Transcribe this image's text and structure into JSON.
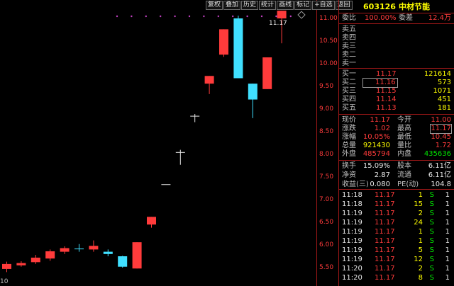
{
  "toolbar": {
    "items": [
      "复权",
      "叠加",
      "历史",
      "统计",
      "画线",
      "标记",
      "+自选",
      "返回"
    ]
  },
  "chart": {
    "price_ticks": [
      "11.00",
      "10.50",
      "10.00",
      "9.50",
      "9.00",
      "8.50",
      "8.00",
      "7.50",
      "7.00",
      "6.50",
      "6.00",
      "5.50"
    ],
    "last_price_label": "11.17",
    "bottom_left_label": "10",
    "up_color": "#ff3b3b",
    "down_color": "#40e0ff",
    "flat_color": "#e8e8e8"
  },
  "chart_data": {
    "type": "candlestick",
    "y_range": [
      5.25,
      11.25
    ],
    "candles": [
      {
        "o": 5.47,
        "c": 5.58,
        "h": 5.63,
        "l": 5.4
      },
      {
        "o": 5.55,
        "c": 5.6,
        "h": 5.64,
        "l": 5.52
      },
      {
        "o": 5.62,
        "c": 5.72,
        "h": 5.78,
        "l": 5.58
      },
      {
        "o": 5.7,
        "c": 5.86,
        "h": 5.9,
        "l": 5.65
      },
      {
        "o": 5.85,
        "c": 5.93,
        "h": 5.97,
        "l": 5.8
      },
      {
        "o": 5.92,
        "c": 5.91,
        "h": 6.02,
        "l": 5.85
      },
      {
        "o": 5.9,
        "c": 5.98,
        "h": 6.1,
        "l": 5.85
      },
      {
        "o": 5.85,
        "c": 5.8,
        "h": 5.9,
        "l": 5.75
      },
      {
        "o": 5.75,
        "c": 5.52,
        "h": 5.76,
        "l": 5.5
      },
      {
        "o": 5.48,
        "c": 6.06,
        "h": 6.06,
        "l": 5.48
      },
      {
        "o": 6.45,
        "c": 6.62,
        "h": 6.62,
        "l": 6.38
      },
      {
        "o": 7.34,
        "c": 7.34,
        "h": 7.34,
        "l": 7.34
      },
      {
        "o": 8.05,
        "c": 8.05,
        "h": 8.1,
        "l": 7.77
      },
      {
        "o": 8.85,
        "c": 8.85,
        "h": 8.89,
        "l": 8.71
      },
      {
        "o": 9.56,
        "c": 9.73,
        "h": 9.73,
        "l": 9.33
      },
      {
        "o": 10.2,
        "c": 10.76,
        "h": 10.76,
        "l": 10.15
      },
      {
        "o": 11.0,
        "c": 9.68,
        "h": 11.06,
        "l": 9.68
      },
      {
        "o": 9.56,
        "c": 9.21,
        "h": 9.56,
        "l": 8.8
      },
      {
        "o": 9.44,
        "c": 10.14,
        "h": 10.14,
        "l": 9.44
      },
      {
        "o": 11.0,
        "c": 11.17,
        "h": 11.17,
        "l": 10.45
      }
    ],
    "markers": 13
  },
  "panel": {
    "code": "603126",
    "name": "中材节能",
    "weibi": {
      "label": "委比",
      "value": "100.00%"
    },
    "weicha": {
      "label": "委差",
      "value": "12.4万"
    },
    "sell": [
      {
        "label": "卖五",
        "price": "",
        "vol": ""
      },
      {
        "label": "卖四",
        "price": "",
        "vol": ""
      },
      {
        "label": "卖三",
        "price": "",
        "vol": ""
      },
      {
        "label": "卖二",
        "price": "",
        "vol": ""
      },
      {
        "label": "卖一",
        "price": "",
        "vol": ""
      }
    ],
    "buy": [
      {
        "label": "买一",
        "price": "11.17",
        "vol": "121614"
      },
      {
        "label": "买二",
        "price": "11.16",
        "vol": "573"
      },
      {
        "label": "买三",
        "price": "11.15",
        "vol": "1071"
      },
      {
        "label": "买四",
        "price": "11.14",
        "vol": "451"
      },
      {
        "label": "买五",
        "price": "11.13",
        "vol": "181"
      }
    ],
    "stats": [
      {
        "l1": "现价",
        "v1": "11.17",
        "c1": "red",
        "l2": "今开",
        "v2": "11.00",
        "c2": "red"
      },
      {
        "l1": "涨跌",
        "v1": "1.02",
        "c1": "red",
        "l2": "最高",
        "v2": "11.17",
        "c2": "red"
      },
      {
        "l1": "涨幅",
        "v1": "10.05%",
        "c1": "red",
        "l2": "最低",
        "v2": "10.45",
        "c2": "red"
      },
      {
        "l1": "总量",
        "v1": "921430",
        "c1": "yel",
        "l2": "量比",
        "v2": "1.72",
        "c2": "red"
      },
      {
        "l1": "外盘",
        "v1": "485794",
        "c1": "red",
        "l2": "内盘",
        "v2": "435636",
        "c2": "grn"
      }
    ],
    "fund": [
      {
        "l1": "换手",
        "v1": "15.09%",
        "l2": "股本",
        "v2": "6.11亿"
      },
      {
        "l1": "净资",
        "v1": "2.87",
        "l2": "流通",
        "v2": "6.11亿"
      },
      {
        "l1": "收益(三)",
        "v1": "0.080",
        "l2": "PE(动)",
        "v2": "104.8"
      }
    ],
    "ticks": [
      {
        "t": "11:18",
        "p": "11.17",
        "v": "1",
        "s": "S",
        "n": "1"
      },
      {
        "t": "11:18",
        "p": "11.17",
        "v": "15",
        "s": "S",
        "n": "1"
      },
      {
        "t": "11:19",
        "p": "11.17",
        "v": "2",
        "s": "S",
        "n": "1"
      },
      {
        "t": "11:19",
        "p": "11.17",
        "v": "24",
        "s": "S",
        "n": "1"
      },
      {
        "t": "11:19",
        "p": "11.17",
        "v": "1",
        "s": "S",
        "n": "1"
      },
      {
        "t": "11:19",
        "p": "11.17",
        "v": "1",
        "s": "S",
        "n": "1"
      },
      {
        "t": "11:19",
        "p": "11.17",
        "v": "5",
        "s": "S",
        "n": "1"
      },
      {
        "t": "11:19",
        "p": "11.17",
        "v": "12",
        "s": "S",
        "n": "1"
      },
      {
        "t": "11:20",
        "p": "11.17",
        "v": "2",
        "s": "S",
        "n": "1"
      },
      {
        "t": "11:20",
        "p": "11.17",
        "v": "8",
        "s": "S",
        "n": "1"
      }
    ]
  }
}
